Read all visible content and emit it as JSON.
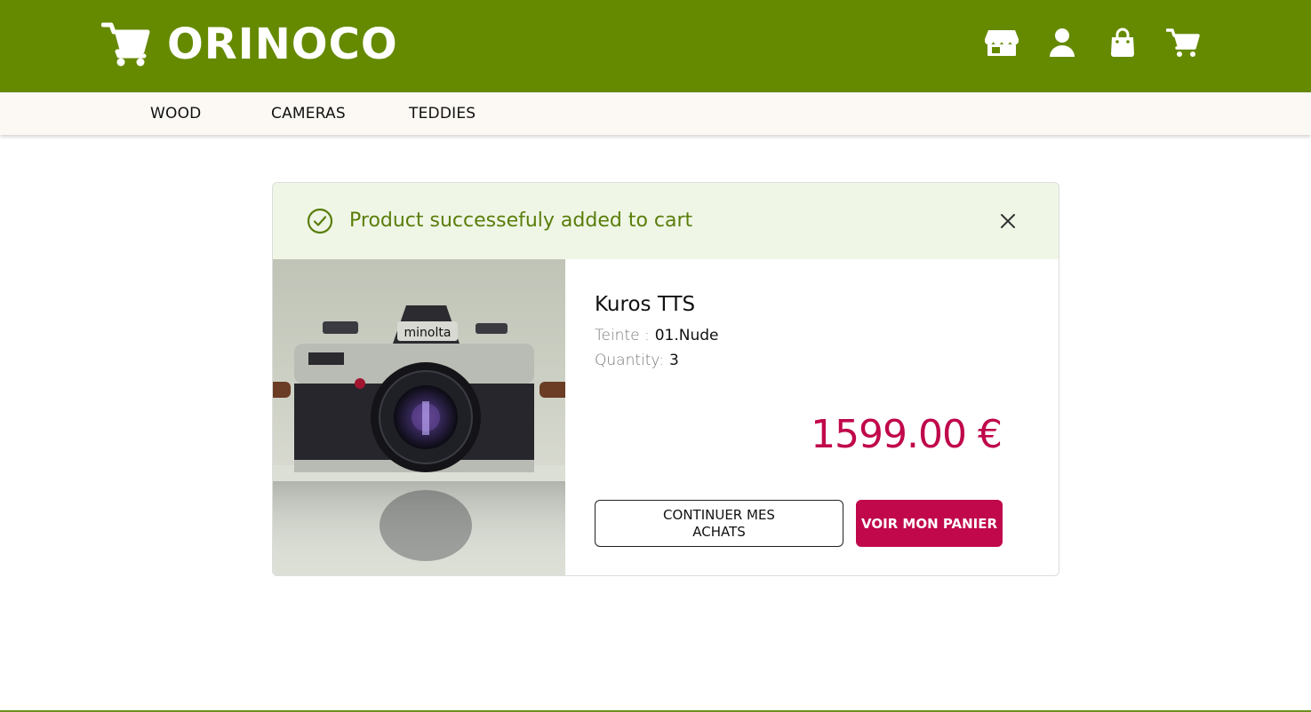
{
  "header": {
    "brand": "ORINOCO",
    "icons": [
      "store-icon",
      "user-icon",
      "shopping-bag-icon",
      "cart-icon"
    ],
    "bg_color": "#658a00"
  },
  "nav": {
    "items": [
      {
        "label": "WOOD"
      },
      {
        "label": "CAMERAS"
      },
      {
        "label": "TEDDIES"
      }
    ]
  },
  "modal": {
    "message": "Product successefuly added to cart",
    "product": {
      "name": "Kuros TTS",
      "tint_label": "Teinte :",
      "tint_value": "01.Nude",
      "quantity_label": "Quantity:",
      "quantity_value": "3",
      "price": "1599.00 €"
    },
    "buttons": {
      "continue": "CONTINUER MES ACHATS",
      "cart": "VOIR MON PANIER"
    },
    "accent_color": "#c0084b",
    "success_color": "#5a7d0a"
  },
  "image": {
    "camera_brand": "minolta"
  }
}
